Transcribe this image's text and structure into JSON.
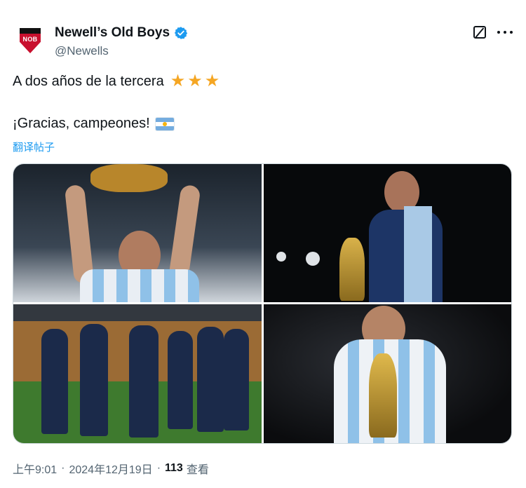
{
  "account": {
    "display_name": "Newell’s Old Boys",
    "handle": "@Newells",
    "logo_text": "NOB",
    "verified": true
  },
  "header_actions": {
    "grok_icon": "grok-icon",
    "more_icon": "more-icon"
  },
  "tweet": {
    "line1": "A dos años de la tercera",
    "stars": [
      "★",
      "★",
      "★"
    ],
    "line2": "¡Gracias, campeones!",
    "flag_icon": "argentina-flag-icon",
    "translate_label": "翻译帖子"
  },
  "media": {
    "photos": [
      {
        "id": "photo-1",
        "subject": "player-lifting-trophy"
      },
      {
        "id": "photo-2",
        "subject": "coach-touching-trophy"
      },
      {
        "id": "photo-3",
        "subject": "staff-standing-by-bench"
      },
      {
        "id": "photo-4",
        "subject": "player-kissing-trophy"
      }
    ]
  },
  "footer": {
    "time": "上午9:01",
    "separator": "·",
    "date": "2024年12月19日",
    "views_count": "113",
    "views_label": "查看"
  },
  "colors": {
    "text": "#0f1419",
    "secondary": "#536471",
    "link": "#1d9bf0",
    "verified": "#1d9bf0",
    "star": "#f5a623"
  }
}
